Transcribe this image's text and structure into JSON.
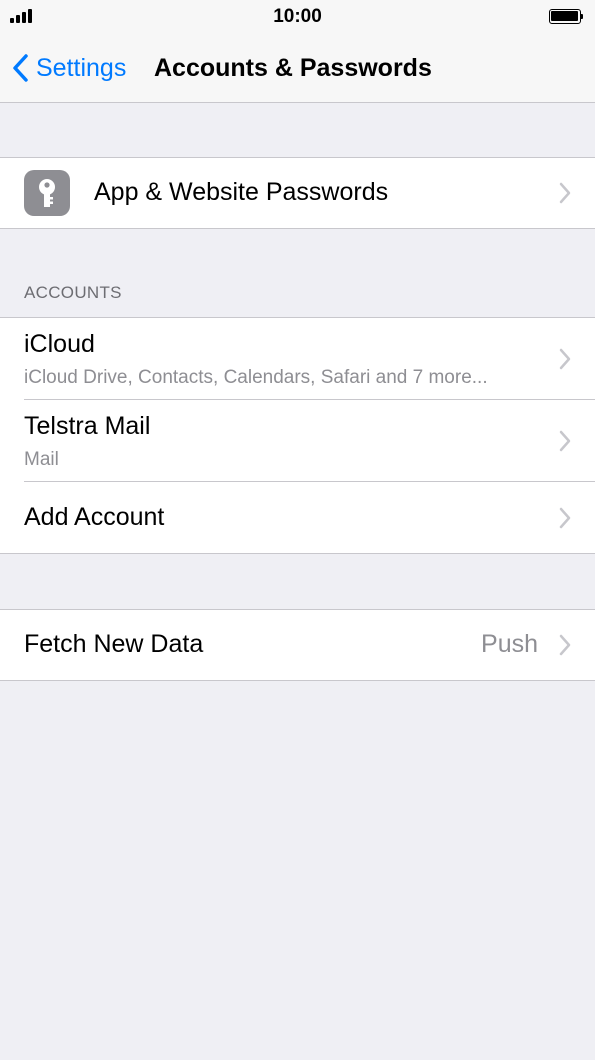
{
  "status_bar": {
    "time": "10:00",
    "signal_icon": "signal-bars-icon",
    "battery_icon": "battery-icon"
  },
  "nav": {
    "back_label": "Settings",
    "title": "Accounts & Passwords"
  },
  "passwords_row": {
    "label": "App & Website Passwords",
    "icon": "key-icon"
  },
  "accounts_section": {
    "header": "ACCOUNTS",
    "items": [
      {
        "title": "iCloud",
        "subtitle": "iCloud Drive, Contacts, Calendars, Safari and 7 more..."
      },
      {
        "title": "Telstra Mail",
        "subtitle": "Mail"
      },
      {
        "title": "Add Account"
      }
    ]
  },
  "fetch_row": {
    "label": "Fetch New Data",
    "value": "Push"
  },
  "colors": {
    "accent": "#007aff",
    "background": "#efeff4",
    "secondary_text": "#8e8e93"
  }
}
